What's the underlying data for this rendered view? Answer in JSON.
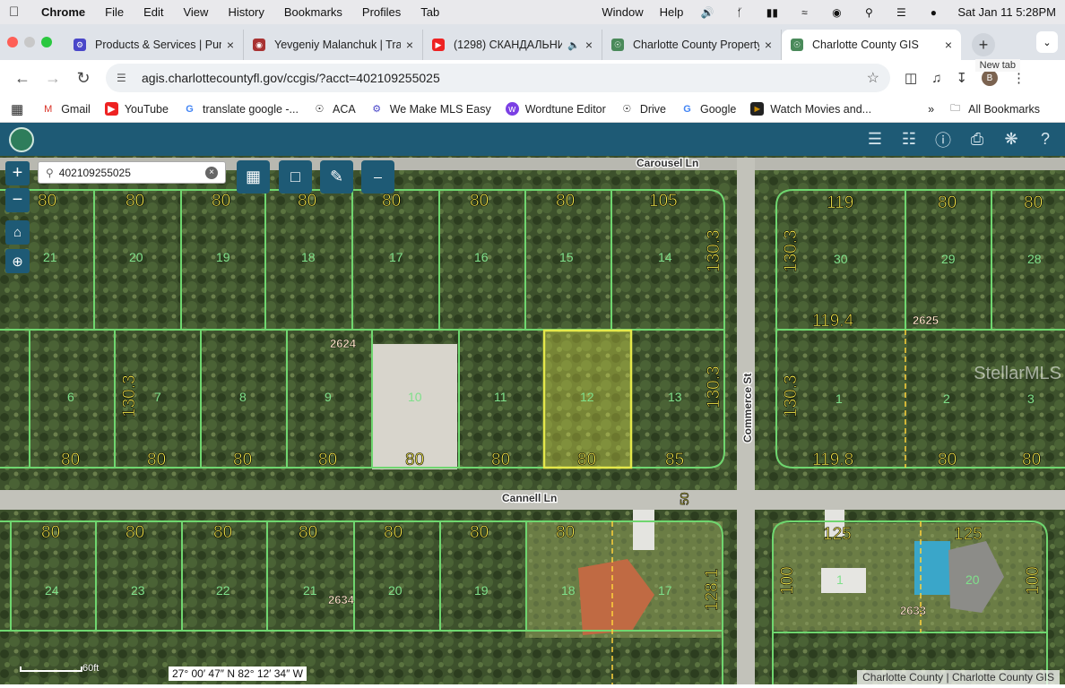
{
  "menubar": {
    "app": "Chrome",
    "items": [
      "File",
      "Edit",
      "View",
      "History",
      "Bookmarks",
      "Profiles",
      "Tab"
    ],
    "right_items": [
      "Window",
      "Help"
    ],
    "datetime": "Sat Jan 11  5:28PM"
  },
  "tabs": [
    {
      "title": "Products & Services | Pun",
      "favicon_color": "#4a47c9",
      "icon": "gear-icon"
    },
    {
      "title": "Yevgeniy Malanchuk | Trar",
      "favicon_color": "#a83232",
      "icon": "avatar-icon"
    },
    {
      "title": "(1298) СКАНДАЛЬНИ",
      "favicon_color": "#e22",
      "icon": "youtube-icon"
    },
    {
      "title": "Charlotte County Property",
      "favicon_color": "#4a8a5a",
      "icon": "globe-icon"
    },
    {
      "title": "Charlotte County GIS",
      "favicon_color": "#4a8a5a",
      "icon": "globe-icon",
      "active": true
    }
  ],
  "tooltip": "New tab",
  "address": {
    "url": "agis.charlottecountyfl.gov/ccgis/?acct=402109255025"
  },
  "bookmarks": [
    {
      "label": "Gmail",
      "icon": "gmail-icon",
      "color": "#d93025"
    },
    {
      "label": "YouTube",
      "icon": "youtube-icon",
      "color": "#e22"
    },
    {
      "label": "translate google -...",
      "icon": "google-icon",
      "color": "#4285f4"
    },
    {
      "label": "ACA",
      "icon": "globe-icon",
      "color": "#222"
    },
    {
      "label": "We Make MLS Easy",
      "icon": "gear-icon",
      "color": "#4a47c9"
    },
    {
      "label": "Wordtune Editor",
      "icon": "wordtune-icon",
      "color": "#7b3fe4"
    },
    {
      "label": "Drive",
      "icon": "globe-icon",
      "color": "#222"
    },
    {
      "label": "Google",
      "icon": "google-icon",
      "color": "#4285f4"
    },
    {
      "label": "Watch Movies and...",
      "icon": "movie-icon",
      "color": "#c78a00"
    }
  ],
  "all_bookmarks": "All Bookmarks",
  "gis": {
    "search_value": "402109255025",
    "coords": "27° 00′ 47″ N 82° 12′ 34″ W",
    "scale_label": "60ft",
    "attribution": "Charlotte County | Charlotte County GIS",
    "watermark": "StellarMLS",
    "streets": {
      "top": "Carousel Ln",
      "middle": "Cannell Ln",
      "vertical": "Commerce St"
    },
    "blocks": {
      "b1": "2624",
      "b2": "2625",
      "b3": "2634",
      "b4": "2633"
    },
    "lots_top_row": [
      "21",
      "20",
      "19",
      "18",
      "17",
      "16",
      "15",
      "14"
    ],
    "lots_mid_row": [
      "6",
      "7",
      "8",
      "9",
      "10",
      "11",
      "12",
      "13"
    ],
    "lots_bottom_row": [
      "24",
      "23",
      "22",
      "21",
      "20",
      "19",
      "18",
      "17"
    ],
    "lots_right_top": [
      "30",
      "29",
      "28"
    ],
    "lots_right_mid": [
      "1",
      "2",
      "3"
    ],
    "lots_right_bottom": [
      "1",
      "20"
    ],
    "dims": {
      "top_row_widths": [
        "80",
        "80",
        "80",
        "80",
        "80",
        "80",
        "80",
        "105"
      ],
      "top_right_widths": [
        "119",
        "80",
        "80"
      ],
      "mid_bottom_widths": [
        "80",
        "80",
        "80",
        "80",
        "80",
        "80",
        "80",
        "85"
      ],
      "right_mid_widths": [
        "119.8",
        "80",
        "80"
      ],
      "right_119_4": "119.4",
      "depths": [
        "130.3",
        "130.3",
        "130.3",
        "130.3"
      ],
      "bottom_row_widths": [
        "80",
        "80",
        "80",
        "80",
        "80",
        "80",
        "80"
      ],
      "bottom_right": [
        "125",
        "125"
      ],
      "bottom_depths": [
        "128.1",
        "100",
        "100"
      ],
      "street_dim": "50"
    }
  },
  "colors": {
    "gis_header": "#1e5a75",
    "lot_line": "#6fd66f",
    "selected_lot": "#e4e84a",
    "dim_text": "#f2e84a"
  }
}
